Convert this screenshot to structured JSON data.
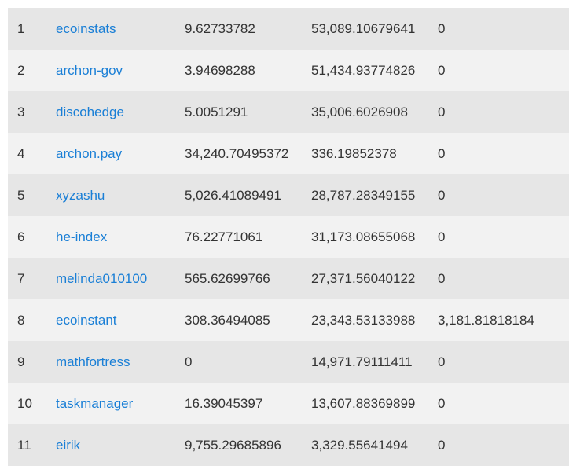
{
  "colors": {
    "row_odd": "#e6e6e6",
    "row_even": "#f2f2f2",
    "link": "#1a7fd6",
    "text": "#333333"
  },
  "rows": [
    {
      "rank": "1",
      "name": "ecoinstats",
      "col_a": "9.62733782",
      "col_b": "53,089.10679641",
      "col_c": "0"
    },
    {
      "rank": "2",
      "name": "archon-gov",
      "col_a": "3.94698288",
      "col_b": "51,434.93774826",
      "col_c": "0"
    },
    {
      "rank": "3",
      "name": "discohedge",
      "col_a": "5.0051291",
      "col_b": "35,006.6026908",
      "col_c": "0"
    },
    {
      "rank": "4",
      "name": "archon.pay",
      "col_a": "34,240.70495372",
      "col_b": "336.19852378",
      "col_c": "0"
    },
    {
      "rank": "5",
      "name": "xyzashu",
      "col_a": "5,026.41089491",
      "col_b": "28,787.28349155",
      "col_c": "0"
    },
    {
      "rank": "6",
      "name": "he-index",
      "col_a": "76.22771061",
      "col_b": "31,173.08655068",
      "col_c": "0"
    },
    {
      "rank": "7",
      "name": "melinda010100",
      "col_a": "565.62699766",
      "col_b": "27,371.56040122",
      "col_c": "0"
    },
    {
      "rank": "8",
      "name": "ecoinstant",
      "col_a": "308.36494085",
      "col_b": "23,343.53133988",
      "col_c": "3,181.81818184"
    },
    {
      "rank": "9",
      "name": "mathfortress",
      "col_a": "0",
      "col_b": "14,971.79111411",
      "col_c": "0"
    },
    {
      "rank": "10",
      "name": "taskmanager",
      "col_a": "16.39045397",
      "col_b": "13,607.88369899",
      "col_c": "0"
    },
    {
      "rank": "11",
      "name": "eirik",
      "col_a": "9,755.29685896",
      "col_b": "3,329.55641494",
      "col_c": "0"
    }
  ]
}
